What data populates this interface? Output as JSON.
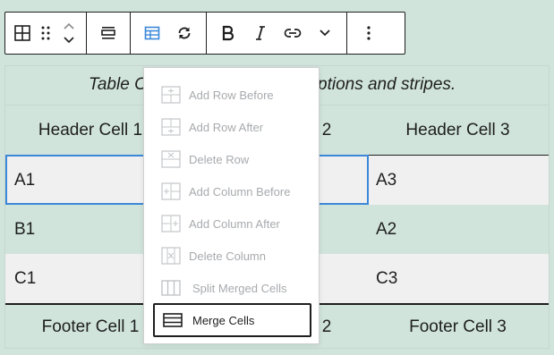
{
  "toolbar": {
    "groups": [
      [
        "table-block-icon",
        "drag-handle-icon",
        "move-up-icon",
        "move-down-icon"
      ],
      [
        "align-icon"
      ],
      [
        "table-edit-icon",
        "transform-icon"
      ],
      [
        "bold-icon",
        "italic-icon",
        "link-icon",
        "more-options-chevron-icon"
      ],
      [
        "kebab-menu-icon"
      ]
    ]
  },
  "table": {
    "caption": "Table Caption with captions and stripes.",
    "caption_visible_left": "Table C",
    "caption_visible_right": "ptions and stripes.",
    "header": [
      "Header Cell 1",
      "Header Cell 2",
      "Header Cell 3"
    ],
    "header_visible": [
      "Header Cell 1",
      "2",
      "Header Cell 3"
    ],
    "rows": [
      [
        "A1",
        "",
        "A3"
      ],
      [
        "B1",
        "",
        "A2"
      ],
      [
        "C1",
        "",
        "C3"
      ]
    ],
    "footer": [
      "Footer Cell 1",
      "2",
      "Footer Cell 3"
    ]
  },
  "menu": {
    "items": [
      {
        "label": "Add Row Before",
        "icon": "add-row-before-icon",
        "enabled": false
      },
      {
        "label": "Add Row After",
        "icon": "add-row-after-icon",
        "enabled": false
      },
      {
        "label": "Delete Row",
        "icon": "delete-row-icon",
        "enabled": false
      },
      {
        "label": "Add Column Before",
        "icon": "add-column-before-icon",
        "enabled": false
      },
      {
        "label": "Add Column After",
        "icon": "add-column-after-icon",
        "enabled": false
      },
      {
        "label": "Delete Column",
        "icon": "delete-column-icon",
        "enabled": false
      },
      {
        "label": "Split Merged Cells",
        "icon": "split-cells-icon",
        "enabled": false
      },
      {
        "label": "Merge Cells",
        "icon": "merge-cells-icon",
        "enabled": true
      }
    ]
  },
  "colors": {
    "background": "#d0e4dc",
    "accent": "#3b88d8",
    "text": "#1e1e1e",
    "disabled": "#a7aaad",
    "stripe": "#f0f0f0"
  }
}
